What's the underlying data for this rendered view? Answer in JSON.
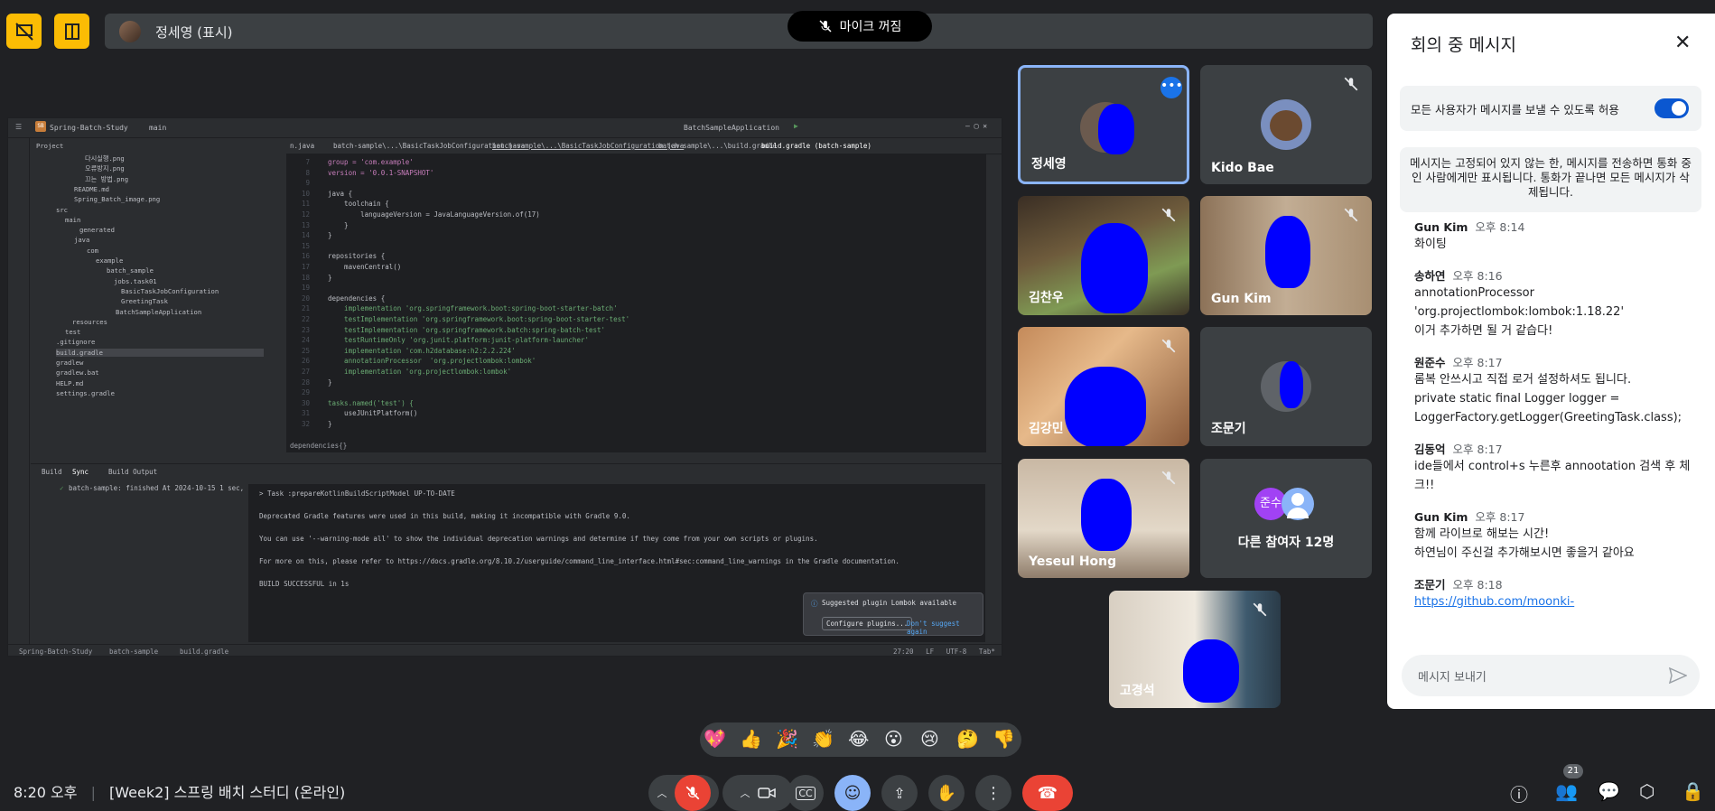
{
  "presenter": {
    "name": "정세영 (표시)",
    "mic_status": "마이크 꺼짐"
  },
  "ide": {
    "project": "Spring-Batch-Study",
    "branch": "main",
    "run_config": "BatchSampleApplication",
    "panel": "Project",
    "tree": [
      "다시실행.png",
      "오류방지.png",
      "끄는 방법.png",
      "README.md",
      "Spring_Batch_image.png",
      "src",
      "main",
      "generated",
      "java",
      "com",
      "example",
      "batch_sample",
      "jobs.task01",
      "BasicTaskJobConfiguration",
      "GreetingTask",
      "BatchSampleApplication",
      "resources",
      "test",
      ".gitignore",
      "build.gradle",
      "gradlew",
      "gradlew.bat",
      "HELP.md",
      "settings.gradle"
    ],
    "tabs": [
      "n.java",
      "batch-sample\\...\\BasicTaskJobConfiguration.java",
      "batch-sample\\...\\BasicTaskJobConfiguration.java",
      "batch-sample\\...\\build.gradle",
      "build.gradle (batch-sample)"
    ],
    "code": [
      {
        "n": "7",
        "t": "group = 'com.example'"
      },
      {
        "n": "8",
        "t": "version = '0.0.1-SNAPSHOT'"
      },
      {
        "n": "9",
        "t": ""
      },
      {
        "n": "10",
        "t": "java {"
      },
      {
        "n": "11",
        "t": "    toolchain {"
      },
      {
        "n": "12",
        "t": "        languageVersion = JavaLanguageVersion.of(17)"
      },
      {
        "n": "13",
        "t": "    }"
      },
      {
        "n": "14",
        "t": "}"
      },
      {
        "n": "15",
        "t": ""
      },
      {
        "n": "16",
        "t": "repositories {"
      },
      {
        "n": "17",
        "t": "    mavenCentral()"
      },
      {
        "n": "18",
        "t": "}"
      },
      {
        "n": "19",
        "t": ""
      },
      {
        "n": "20",
        "t": "dependencies {"
      },
      {
        "n": "21",
        "t": "    implementation 'org.springframework.boot:spring-boot-starter-batch'"
      },
      {
        "n": "22",
        "t": "    testImplementation 'org.springframework.boot:spring-boot-starter-test'"
      },
      {
        "n": "23",
        "t": "    testImplementation 'org.springframework.batch:spring-batch-test'"
      },
      {
        "n": "24",
        "t": "    testRuntimeOnly 'org.junit.platform:junit-platform-launcher'"
      },
      {
        "n": "25",
        "t": "    implementation 'com.h2database:h2:2.2.224'"
      },
      {
        "n": "26",
        "t": "    annotationProcessor  'org.projectlombok:lombok'"
      },
      {
        "n": "27",
        "t": "    implementation 'org.projectlombok:lombok'"
      },
      {
        "n": "28",
        "t": "}"
      },
      {
        "n": "29",
        "t": ""
      },
      {
        "n": "30",
        "t": "tasks.named('test') {"
      },
      {
        "n": "31",
        "t": "    useJUnitPlatform()"
      },
      {
        "n": "32",
        "t": "}"
      }
    ],
    "breadcrumb_editor": "dependencies{}",
    "build_tabs": [
      "Build",
      "Sync",
      "Build Output"
    ],
    "build_result": "batch-sample: finished At 2024-10-15 1 sec, 505 ms",
    "console": [
      "> Task :prepareKotlinBuildScriptModel UP-TO-DATE",
      "Deprecated Gradle features were used in this build, making it incompatible with Gradle 9.0.",
      "You can use '--warning-mode all' to show the individual deprecation warnings and determine if they come from your own scripts or plugins.",
      "For more on this, please refer to https://docs.gradle.org/8.10.2/userguide/command_line_interface.html#sec:command_line_warnings in the Gradle documentation.",
      "BUILD SUCCESSFUL in 1s"
    ],
    "notification": {
      "text": "Suggested plugin Lombok available",
      "configure": "Configure plugins...",
      "dismiss": "Don't suggest again"
    },
    "status_path": [
      "Spring-Batch-Study",
      "batch-sample",
      "build.gradle"
    ],
    "status_right": "27:20   LF   UTF-8   Tab*"
  },
  "participants": [
    {
      "name": "정세영",
      "active": true
    },
    {
      "name": "Kido Bae"
    },
    {
      "name": "김찬우"
    },
    {
      "name": "Gun Kim"
    },
    {
      "name": "김강민"
    },
    {
      "name": "조문기"
    },
    {
      "name": "Yeseul Hong"
    },
    {
      "name": "다른 참여자 12명",
      "initials": "준수"
    },
    {
      "name": "고경석"
    }
  ],
  "chat": {
    "title": "회의 중 메시지",
    "allow_label": "모든 사용자가 메시지를 보낼 수 있도록 허용",
    "info": "메시지는 고정되어 있지 않는 한, 메시지를 전송하면 통화 중인 사람에게만 표시됩니다. 통화가 끝나면 모든 메시지가 삭제됩니다.",
    "messages": [
      {
        "who": "Gun Kim",
        "time": "오후 8:14",
        "lines": [
          "화이팅"
        ]
      },
      {
        "who": "송하연",
        "time": "오후 8:16",
        "lines": [
          "annotationProcessor",
          "'org.projectlombok:lombok:1.18.22'",
          "이거 추가하면 될 거 같습다!"
        ]
      },
      {
        "who": "원준수",
        "time": "오후 8:17",
        "lines": [
          "롬복 안쓰시고 직접 로거 설정하셔도 됩니다.",
          "private static final Logger logger =",
          "LoggerFactory.getLogger(GreetingTask.class);"
        ]
      },
      {
        "who": "김동억",
        "time": "오후 8:17",
        "lines": [
          "ide들에서 control+s 누른후 annootation 검색 후 체",
          "크!!"
        ]
      },
      {
        "who": "Gun Kim",
        "time": "오후 8:17",
        "lines": [
          "함께 라이브로 해보는 시간!",
          "하연님이 주신걸 추가해보시면 좋을거 같아요"
        ]
      },
      {
        "who": "조문기",
        "time": "오후 8:18",
        "link": "https://github.com/moonki-"
      }
    ],
    "input_placeholder": "메시지 보내기"
  },
  "bottom": {
    "time": "8:20 오후",
    "meeting_title": "[Week2] 스프링 배치 스터디 (온라인)",
    "participant_count": "21"
  },
  "reactions": [
    "💖",
    "👍",
    "🎉",
    "👏",
    "😂",
    "😮",
    "😢",
    "🤔",
    "👎"
  ],
  "colors": {
    "accent": "#8ab4f8",
    "end_call": "#ea4335",
    "mic_off": "#ea4335",
    "highlight": "#fbbc04"
  }
}
